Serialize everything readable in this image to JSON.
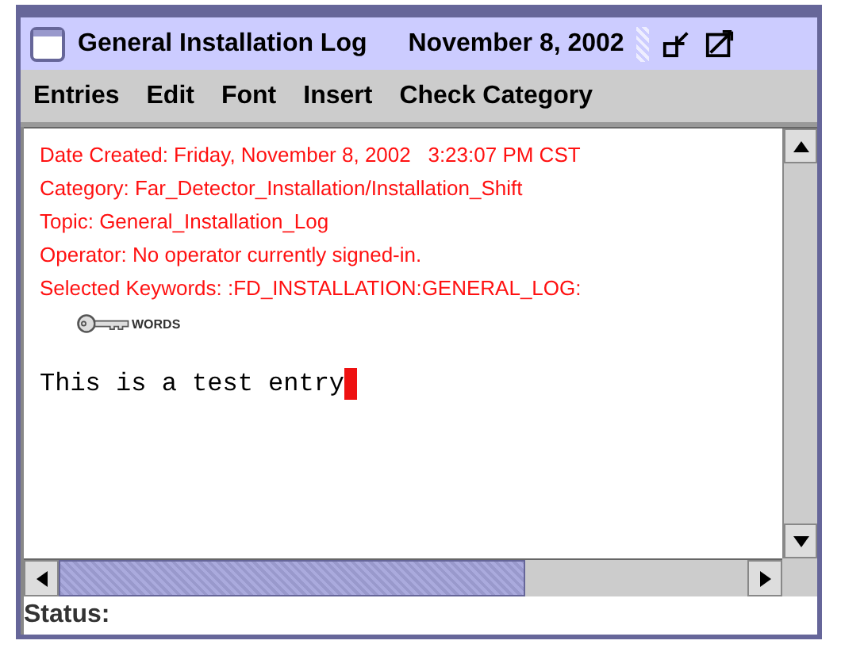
{
  "window": {
    "title": "General Installation Log",
    "date": "November 8, 2002"
  },
  "menu": [
    {
      "label": "Entries"
    },
    {
      "label": "Edit"
    },
    {
      "label": "Font"
    },
    {
      "label": "Insert"
    },
    {
      "label": "Check Category"
    }
  ],
  "header_lines": [
    "Date Created: Friday, November 8, 2002   3:23:07 PM CST",
    "Category: Far_Detector_Installation/Installation_Shift",
    "Topic: General_Installation_Log",
    "Operator: No operator currently signed-in.",
    "Selected Keywords: :FD_INSTALLATION:GENERAL_LOG:"
  ],
  "keyword_badge": "WORDS",
  "entry_text": "This is a test entry",
  "status_bar": {
    "label": "Status:"
  }
}
